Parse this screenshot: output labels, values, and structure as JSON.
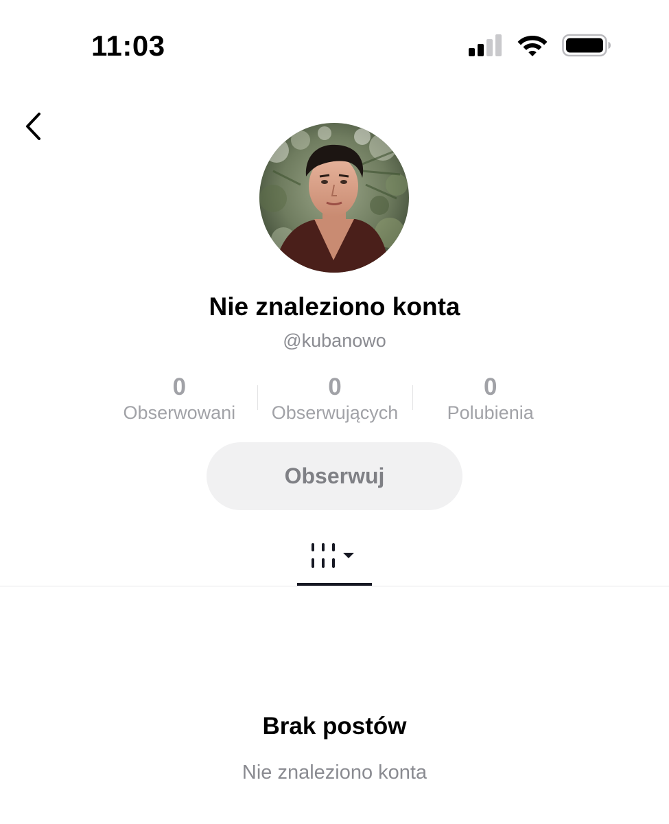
{
  "status_bar": {
    "time": "11:03",
    "icons": [
      "signal-icon",
      "wifi-icon",
      "battery-icon"
    ]
  },
  "header": {
    "back_icon": "chevron-left-icon"
  },
  "profile": {
    "avatar": "profile-photo",
    "name": "Nie znaleziono konta",
    "handle": "@kubanowo",
    "stats": [
      {
        "value": "0",
        "label": "Obserwowani"
      },
      {
        "value": "0",
        "label": "Obserwujących"
      },
      {
        "value": "0",
        "label": "Polubienia"
      }
    ],
    "follow_button_label": "Obserwuj"
  },
  "tabs": {
    "active": "videos",
    "items": [
      {
        "icon": "videos-grid-icon",
        "dropdown_icon": "caret-down-icon"
      }
    ]
  },
  "empty_state": {
    "title": "Brak postów",
    "subtitle": "Nie znaleziono konta"
  },
  "colors": {
    "primary_text": "#000000",
    "secondary_text": "#8a8b91",
    "stat_text": "#a1a2a7",
    "button_bg": "#f1f1f2",
    "button_text": "#7f8085",
    "tab_indicator": "#161823"
  }
}
